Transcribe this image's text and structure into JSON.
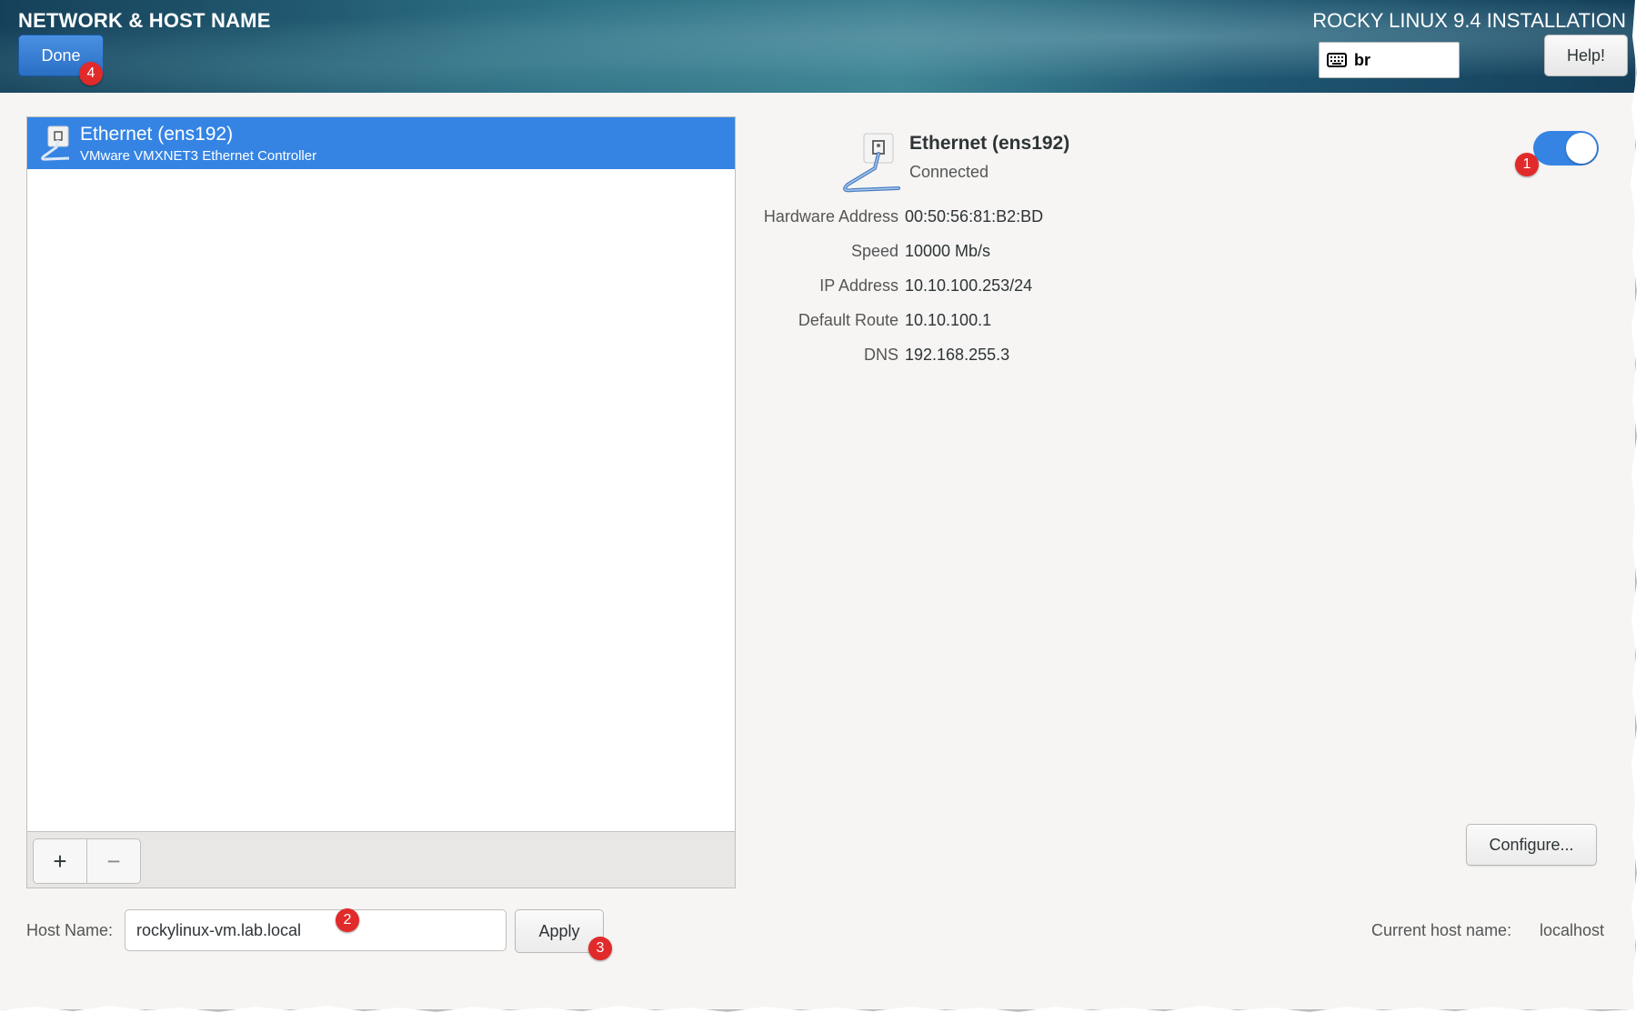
{
  "header": {
    "page_title": "NETWORK & HOST NAME",
    "product_title": "ROCKY LINUX 9.4 INSTALLATION",
    "done_label": "Done",
    "keyboard_layout": "br",
    "help_label": "Help!"
  },
  "device_list": {
    "items": [
      {
        "name": "Ethernet (ens192)",
        "description": "VMware VMXNET3 Ethernet Controller",
        "selected": true
      }
    ],
    "add_label": "+",
    "remove_label": "−"
  },
  "details": {
    "name": "Ethernet (ens192)",
    "status": "Connected",
    "enabled": true,
    "rows": [
      {
        "label": "Hardware Address",
        "value": "00:50:56:81:B2:BD"
      },
      {
        "label": "Speed",
        "value": "10000 Mb/s"
      },
      {
        "label": "IP Address",
        "value": "10.10.100.253/24"
      },
      {
        "label": "Default Route",
        "value": "10.10.100.1"
      },
      {
        "label": "DNS",
        "value": "192.168.255.3"
      }
    ],
    "configure_label": "Configure..."
  },
  "hostname": {
    "label": "Host Name:",
    "value": "rockylinux-vm.lab.local",
    "apply_label": "Apply",
    "current_label": "Current host name:",
    "current_value": "localhost"
  },
  "callouts": [
    "1",
    "2",
    "3",
    "4"
  ],
  "colors": {
    "accent": "#3584e4",
    "callout": "#e12a2a"
  }
}
